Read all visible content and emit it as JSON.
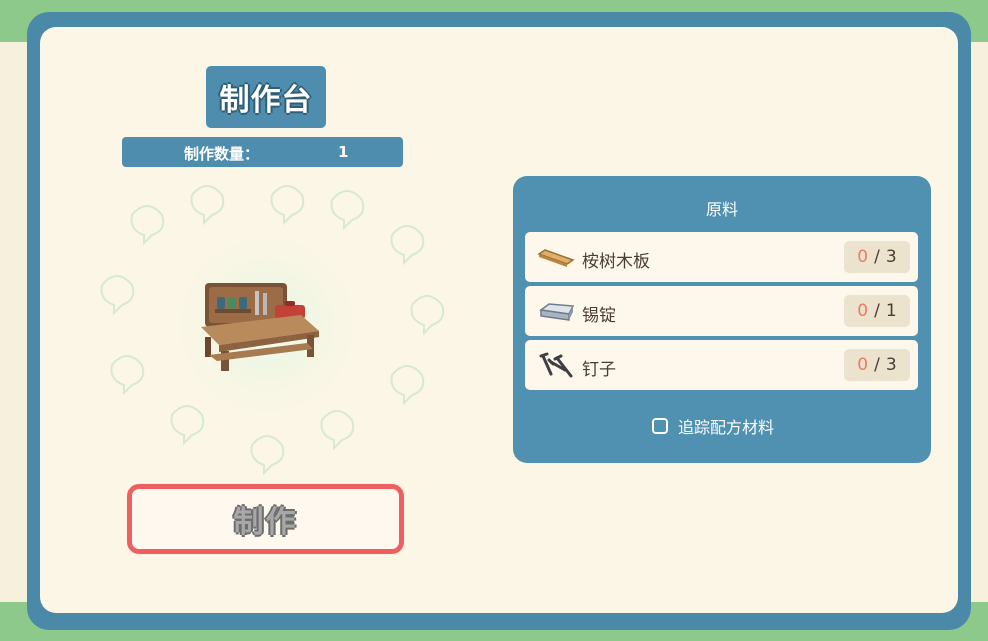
{
  "recipe": {
    "title": "制作台",
    "quantity_label": "制作数量：",
    "quantity_value": "1"
  },
  "craft_button_label": "制作",
  "materials": {
    "title": "原料",
    "items": [
      {
        "name": "桉树木板",
        "have": "0",
        "need": "3",
        "icon": "wood-plank-icon"
      },
      {
        "name": "锡锭",
        "have": "0",
        "need": "1",
        "icon": "tin-ingot-icon"
      },
      {
        "name": "钉子",
        "have": "0",
        "need": "3",
        "icon": "nails-icon"
      }
    ],
    "track_label": "追踪配方材料"
  },
  "colors": {
    "panel_blue": "#4e8dad",
    "frame_blue": "#4a8aa8",
    "panel_cream": "#fcf6e6",
    "button_border": "#ee6060",
    "have_count": "#ee7b62",
    "outer_green": "#8cc98a"
  }
}
